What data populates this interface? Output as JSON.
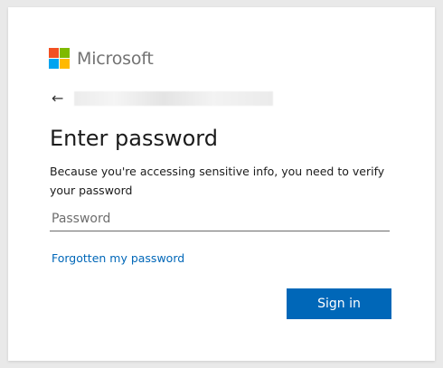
{
  "brand": {
    "name": "Microsoft",
    "logo_colors": [
      "#f25022",
      "#7fba00",
      "#00a4ef",
      "#ffb900"
    ]
  },
  "identity": {
    "back_icon": "←",
    "email": ""
  },
  "page": {
    "title": "Enter password",
    "description": "Because you're accessing sensitive info, you need to verify your password"
  },
  "form": {
    "password_value": "",
    "password_placeholder": "Password",
    "forgot_link": "Forgotten my password",
    "submit_label": "Sign in"
  },
  "colors": {
    "accent": "#0067b8",
    "page_background": "#e9e9e9",
    "card_background": "#ffffff"
  }
}
